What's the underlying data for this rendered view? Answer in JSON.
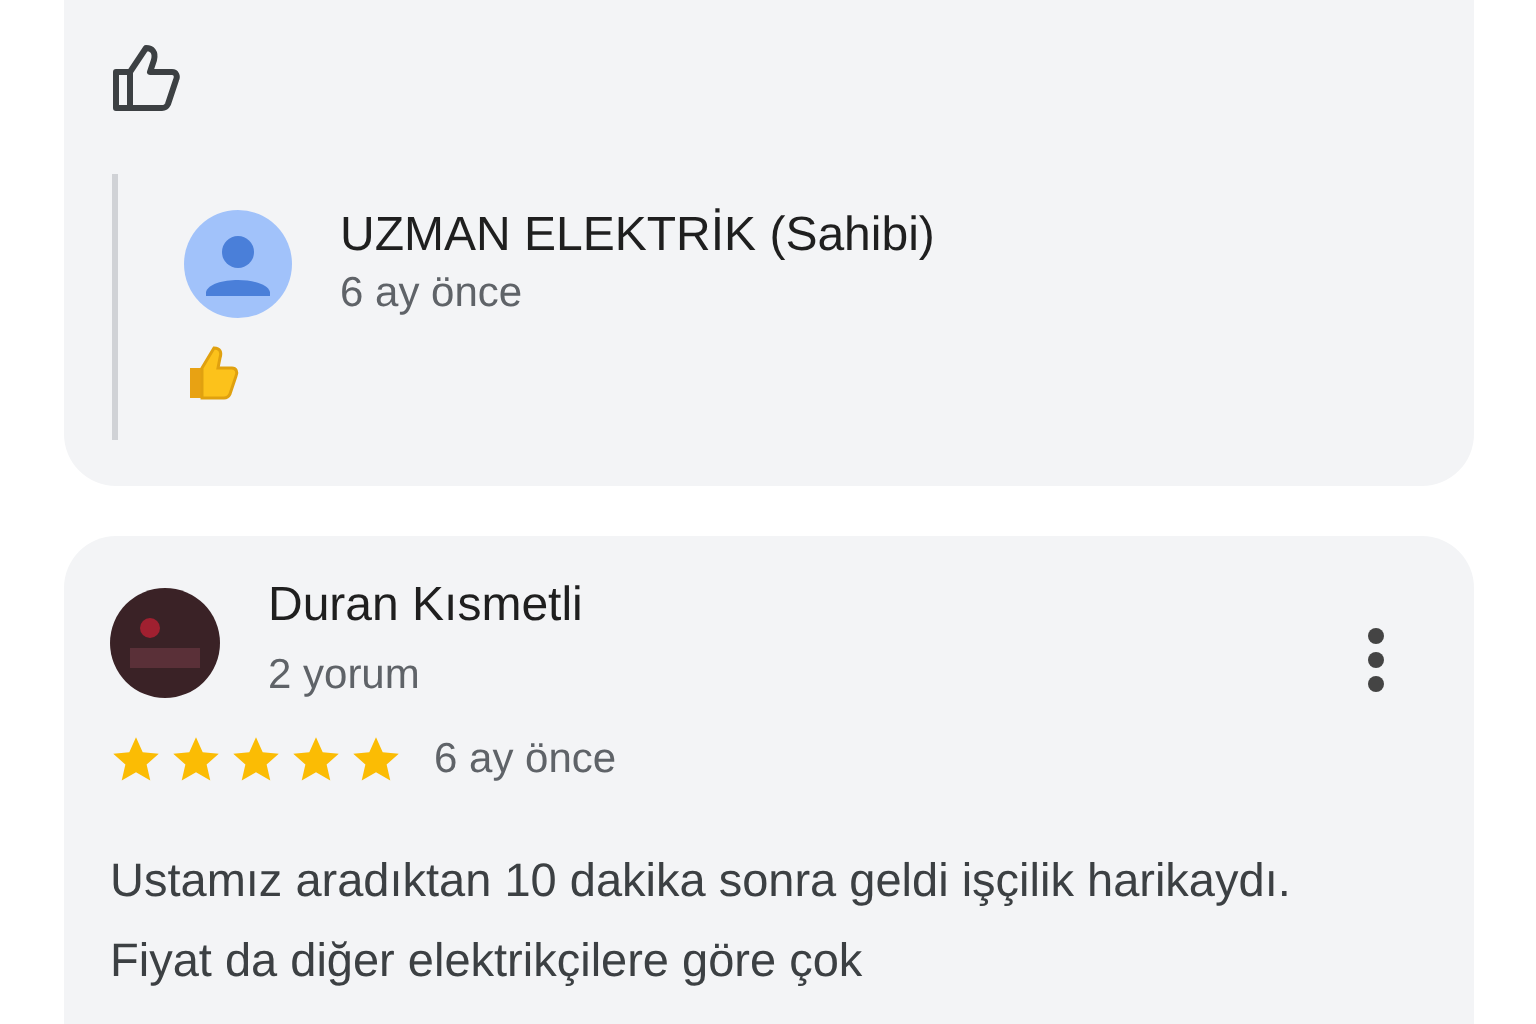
{
  "reply_card": {
    "owner_name": "UZMAN ELEKTRİK (Sahibi)",
    "owner_time": "6 ay önce"
  },
  "review": {
    "author": "Duran Kısmetli",
    "author_meta": "2 yorum",
    "stars": 5,
    "time": "6 ay önce",
    "text": "Ustamız aradıktan 10 dakika sonra geldi işçilik harikaydı. Fiyat da diğer elektrikçilere göre çok"
  }
}
